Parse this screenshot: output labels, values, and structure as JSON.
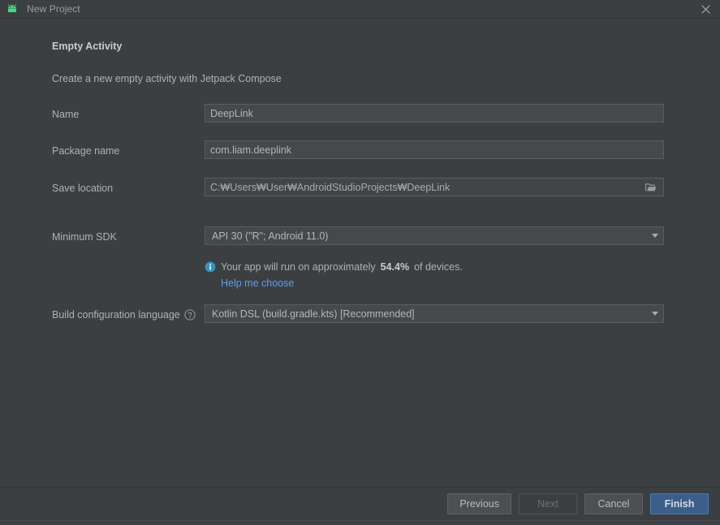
{
  "window": {
    "title": "New Project",
    "app_icon": "android-robot-icon",
    "close_icon": "close-icon",
    "accent_blue": "#3592C4",
    "link_blue": "#589DF6",
    "primary_button_bg": "#3C5E8B",
    "background": "#3C3F41",
    "field_background": "#45494A"
  },
  "form": {
    "heading": "Empty Activity",
    "subtitle": "Create a new empty activity with Jetpack Compose",
    "fields": {
      "name": {
        "label": "Name",
        "value": "DeepLink",
        "placeholder": "Name"
      },
      "package_name": {
        "label": "Package name",
        "value": "com.liam.deeplink",
        "placeholder": "Package name"
      },
      "save_location": {
        "label": "Save location",
        "value": "C:₩Users₩User₩AndroidStudioProjects₩DeepLink",
        "placeholder": "Save location",
        "browse_icon": "folder-icon"
      },
      "minimum_sdk": {
        "label": "Minimum SDK",
        "value": "API 30 (\"R\"; Android 11.0)",
        "dropdown_icon": "chevron-down-icon"
      },
      "build_config_language": {
        "label": "Build configuration language",
        "help_icon": "help-circle-icon",
        "value": "Kotlin DSL (build.gradle.kts) [Recommended]",
        "dropdown_icon": "chevron-down-icon"
      }
    },
    "sdk_info": {
      "icon": "info-icon",
      "text_before": "Your app will run on approximately",
      "percentage": "54.4%",
      "text_after": "of devices.",
      "link_label": "Help me choose"
    }
  },
  "footer": {
    "buttons": [
      {
        "label": "Previous",
        "state": "enabled"
      },
      {
        "label": "Next",
        "state": "disabled"
      },
      {
        "label": "Cancel",
        "state": "enabled"
      },
      {
        "label": "Finish",
        "state": "primary"
      }
    ]
  }
}
